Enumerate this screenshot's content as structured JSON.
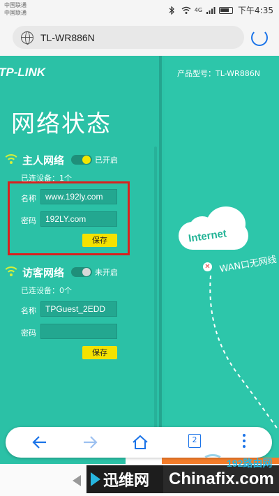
{
  "statusbar": {
    "carrier1": "中国联通",
    "carrier2": "中国联通",
    "signal_text": "4G",
    "time": "下午4:35"
  },
  "browser": {
    "url": "TL-WR886N"
  },
  "router_page": {
    "logo": "TP-LINK",
    "model_label": "产品型号：TL-WR886N",
    "page_title": "网络状态",
    "main_network": {
      "title": "主人网络",
      "toggle_state": "on",
      "toggle_label": "已开启",
      "connected": "已连设备：1个",
      "name_label": "名称",
      "name_value": "www.192ly.com",
      "password_label": "密码",
      "password_value": "192LY.com",
      "save_label": "保存"
    },
    "guest_network": {
      "title": "访客网络",
      "toggle_state": "off",
      "toggle_label": "未开启",
      "connected": "已连设备：0个",
      "name_label": "名称",
      "name_value": "TPGuest_2EDD",
      "password_label": "密码",
      "password_value": "",
      "save_label": "保存"
    },
    "diagram": {
      "cloud_label": "Internet",
      "wan_status": "WAN口无网线"
    }
  },
  "navbar": {
    "tab_count": "2"
  },
  "watermark": {
    "left_brand": "迅维网",
    "right_brand": "Chinafix.com",
    "corner_brand": "192路由网"
  },
  "colors": {
    "panel": "#2bc1a6",
    "accent_yellow": "#f4e200",
    "highlight_red": "#d8211f",
    "browser_blue": "#1a73e8"
  }
}
